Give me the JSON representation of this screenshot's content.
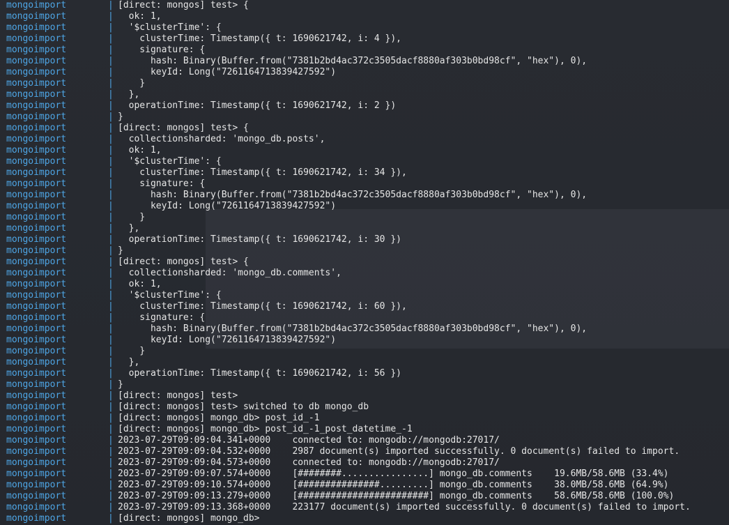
{
  "terminal": {
    "prefix": "mongoimport",
    "separator": "|",
    "colors": {
      "background": "#2a2d33",
      "prefix": "#4ea6e6",
      "text": "#e6e6e6"
    },
    "lines": [
      "[direct: mongos] test> {",
      "  ok: 1,",
      "  '$clusterTime': {",
      "    clusterTime: Timestamp({ t: 1690621742, i: 4 }),",
      "    signature: {",
      "      hash: Binary(Buffer.from(\"7381b2bd4ac372c3505dacf8880af303b0bd98cf\", \"hex\"), 0),",
      "      keyId: Long(\"7261164713839427592\")",
      "    }",
      "  },",
      "  operationTime: Timestamp({ t: 1690621742, i: 2 })",
      "}",
      "[direct: mongos] test> {",
      "  collectionsharded: 'mongo_db.posts',",
      "  ok: 1,",
      "  '$clusterTime': {",
      "    clusterTime: Timestamp({ t: 1690621742, i: 34 }),",
      "    signature: {",
      "      hash: Binary(Buffer.from(\"7381b2bd4ac372c3505dacf8880af303b0bd98cf\", \"hex\"), 0),",
      "      keyId: Long(\"7261164713839427592\")",
      "    }",
      "  },",
      "  operationTime: Timestamp({ t: 1690621742, i: 30 })",
      "}",
      "[direct: mongos] test> {",
      "  collectionsharded: 'mongo_db.comments',",
      "  ok: 1,",
      "  '$clusterTime': {",
      "    clusterTime: Timestamp({ t: 1690621742, i: 60 }),",
      "    signature: {",
      "      hash: Binary(Buffer.from(\"7381b2bd4ac372c3505dacf8880af303b0bd98cf\", \"hex\"), 0),",
      "      keyId: Long(\"7261164713839427592\")",
      "    }",
      "  },",
      "  operationTime: Timestamp({ t: 1690621742, i: 56 })",
      "}",
      "[direct: mongos] test>",
      "[direct: mongos] test> switched to db mongo_db",
      "[direct: mongos] mongo_db> post_id_-1",
      "[direct: mongos] mongo_db> post_id_-1_post_datetime_-1",
      "2023-07-29T09:09:04.341+0000\tconnected to: mongodb://mongodb:27017/",
      "2023-07-29T09:09:04.532+0000\t2987 document(s) imported successfully. 0 document(s) failed to import.",
      "2023-07-29T09:09:04.573+0000\tconnected to: mongodb://mongodb:27017/",
      "2023-07-29T09:09:07.574+0000\t[########................] mongo_db.comments    19.6MB/58.6MB (33.4%)",
      "2023-07-29T09:09:10.574+0000\t[###############.........] mongo_db.comments    38.0MB/58.6MB (64.9%)",
      "2023-07-29T09:09:13.279+0000\t[########################] mongo_db.comments    58.6MB/58.6MB (100.0%)",
      "2023-07-29T09:09:13.368+0000\t223177 document(s) imported successfully. 0 document(s) failed to import.",
      "[direct: mongos] mongo_db>"
    ]
  }
}
